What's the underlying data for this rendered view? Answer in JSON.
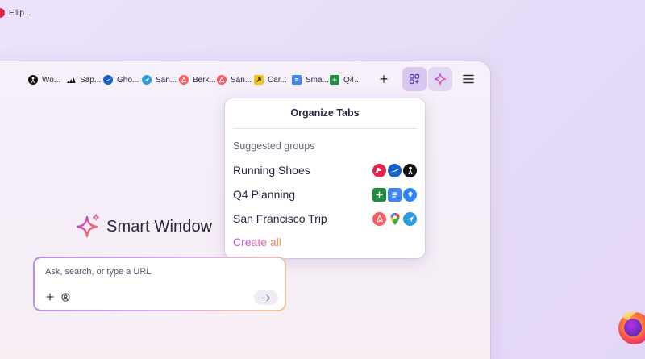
{
  "colors": {
    "accent": "#b94be8",
    "accent_orange": "#f19a3c",
    "active_button_bg": "#d7c8f2"
  },
  "tabs": [
    {
      "label": "Ellip...",
      "icon": "brand-red-icon",
      "color": "#e3264b"
    },
    {
      "label": "Wo...",
      "icon": "person-icon",
      "color": "#111111"
    },
    {
      "label": "Sap...",
      "icon": "adidas-icon",
      "color": "#111111"
    },
    {
      "label": "Gho...",
      "icon": "swoosh-icon",
      "color": "#1762c8"
    },
    {
      "label": "San...",
      "icon": "plane-icon",
      "color": "#2d9cdb"
    },
    {
      "label": "Berk...",
      "icon": "airbnb-icon",
      "color": "#ff5a5f"
    },
    {
      "label": "San...",
      "icon": "airbnb-icon",
      "color": "#ff5a5f"
    },
    {
      "label": "Car...",
      "icon": "arrow-icon",
      "color": "#f5c518"
    },
    {
      "label": "Sma...",
      "icon": "doc-icon",
      "color": "#4285f4"
    },
    {
      "label": "Q4...",
      "icon": "sheet-icon",
      "color": "#1e8e3e"
    }
  ],
  "toolbar": {
    "new_tab": "+",
    "organize_icon": "tab-groups-icon",
    "ai_icon": "sparkle-icon",
    "menu_icon": "hamburger-icon"
  },
  "popup": {
    "title": "Organize Tabs",
    "subtitle": "Suggested groups",
    "groups": [
      {
        "name": "Running Shoes",
        "icons": [
          "new-balance-icon",
          "swoosh-icon",
          "person-icon"
        ]
      },
      {
        "name": "Q4 Planning",
        "icons": [
          "sheet-icon",
          "doc-icon",
          "jira-icon"
        ]
      },
      {
        "name": "San Francisco Trip",
        "icons": [
          "airbnb-icon",
          "maps-icon",
          "plane-icon"
        ]
      }
    ],
    "create_all": "Create all"
  },
  "brand": {
    "text": "Smart Window"
  },
  "search": {
    "placeholder": "Ask, search, or type a URL"
  }
}
